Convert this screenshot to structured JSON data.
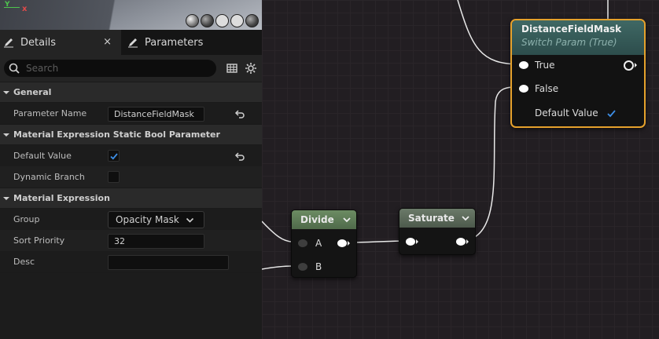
{
  "viewport": {
    "axis_y": "Y",
    "axis_x": "x",
    "preview_tools": [
      "sphere-preview-icon",
      "cylinder-preview-icon",
      "plane-preview-icon",
      "cube-preview-icon",
      "mesh-preview-icon"
    ]
  },
  "tabs": [
    {
      "label": "Details",
      "icon": "pencil-icon",
      "active": true,
      "close": "×"
    },
    {
      "label": "Parameters",
      "icon": "pencil-icon",
      "active": false
    }
  ],
  "search": {
    "placeholder": "Search"
  },
  "sections": {
    "general": {
      "title": "General",
      "parameter_name_label": "Parameter Name",
      "parameter_name_value": "DistanceFieldMask"
    },
    "static_bool": {
      "title": "Material Expression Static Bool Parameter",
      "default_value_label": "Default Value",
      "default_value_checked": true,
      "dynamic_branch_label": "Dynamic Branch",
      "dynamic_branch_checked": false
    },
    "material_expression": {
      "title": "Material Expression",
      "group_label": "Group",
      "group_value": "Opacity Mask",
      "sort_priority_label": "Sort Priority",
      "sort_priority_value": "32",
      "desc_label": "Desc",
      "desc_value": ""
    }
  },
  "nodes": {
    "divide": {
      "title": "Divide",
      "pin_a": "A",
      "pin_b": "B",
      "header_color": "#5c7c55"
    },
    "saturate": {
      "title": "Saturate",
      "header_color": "#5a6a59"
    },
    "switch": {
      "title": "DistanceFieldMask",
      "subtitle": "Switch Param (True)",
      "pin_true": "True",
      "pin_false": "False",
      "default_value_label": "Default Value",
      "default_value_checked": true,
      "border_color": "#e5a12c"
    }
  },
  "colors": {
    "accent_check": "#3d8ee6",
    "wire": "#e8e8e8"
  }
}
